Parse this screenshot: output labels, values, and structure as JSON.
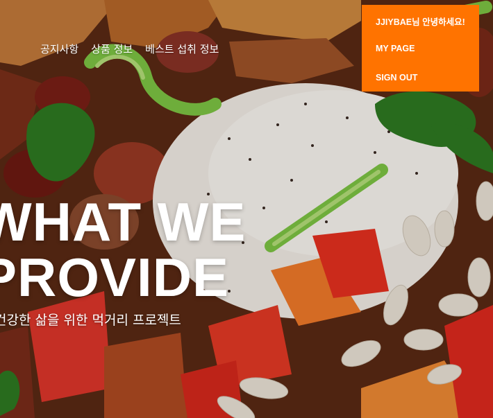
{
  "nav": {
    "items": [
      "공지사항",
      "상품 정보",
      "베스트 섭취 정보"
    ]
  },
  "user_menu": {
    "greeting": "JJIYBAE님 안녕하세요!",
    "my_page": "MY PAGE",
    "sign_out": "SIGN OUT",
    "background_color": "#ff7300"
  },
  "hero": {
    "title_line1": "WHAT WE",
    "title_line2": "PROVIDE",
    "subtitle": "건강한 삶을 위한 먹거리 프로젝트"
  }
}
